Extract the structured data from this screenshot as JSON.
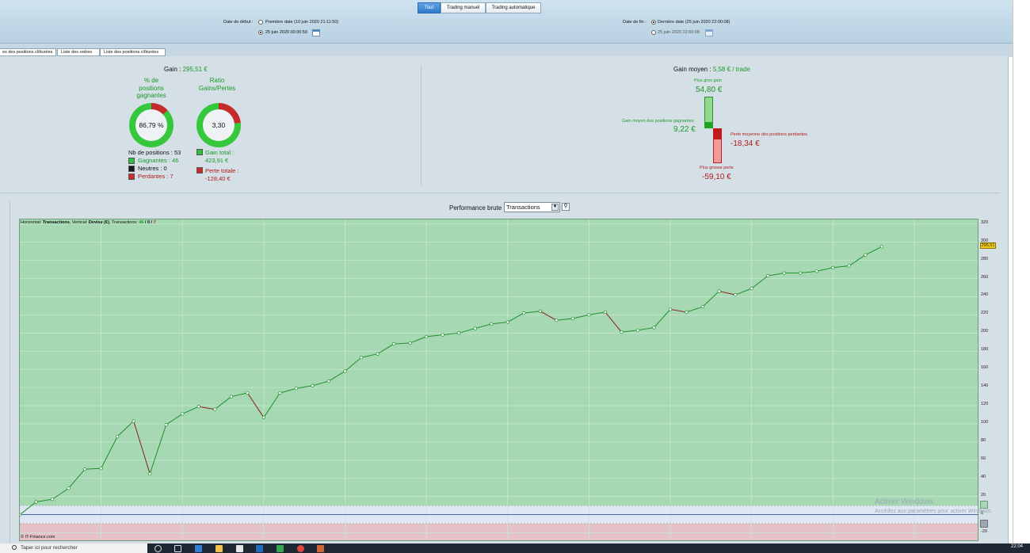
{
  "header": {
    "modes": [
      "Tout",
      "Trading manuel",
      "Trading automatique"
    ],
    "active_mode": "Tout",
    "start_label": "Date de début :",
    "start_opt1": "Première date (10 juin 2020 21:11:50)",
    "start_opt2": "25 juin 2020 00:00:50",
    "end_label": "Date de fin :",
    "end_opt1": "Dernière date (25 juin 2020 22:00:08)",
    "end_opt2": "25 juin 2020 22:00:08"
  },
  "tabs": [
    "es des positions clôturées",
    "Liste des ordres",
    "Liste des positions clôturées"
  ],
  "summary": {
    "gain_label": "Gain : ",
    "gain_value": "295,51 €",
    "pct_title_1": "% de",
    "pct_title_2": "positions",
    "pct_title_3": "gagnantes",
    "pct_value": "86,79 %",
    "pct_fraction": 0.8679,
    "ratio_title_1": "Ratio",
    "ratio_title_2": "Gains/Pertes",
    "ratio_value": "3,30",
    "ratio_fraction": 0.768,
    "nb_positions": "Nb de positions : 53",
    "gagnantes": "Gagnantes : 46",
    "neutres": "Neutres : 0",
    "perdantes": "Perdantes : 7",
    "gain_total_label": "Gain total :",
    "gain_total_value": "423,91 €",
    "perte_totale_label": "Perte totale :",
    "perte_totale_value": "-128,40 €"
  },
  "average": {
    "label": "Gain moyen : ",
    "value": "5,58 € / trade",
    "plus_gros_gain_label": "Plus gros gain",
    "plus_gros_gain_value": "54,80 €",
    "gain_moyen_label": "Gain moyen des positions gagnantes",
    "gain_moyen_value": "9,22 €",
    "perte_moyenne_label": "Perte moyenne des positions perdantes",
    "perte_moyenne_value": "-18,34 €",
    "plus_grosse_perte_label": "Plus grosse perte",
    "plus_grosse_perte_value": "-59,10 €"
  },
  "performance": {
    "title": "Performance brute",
    "select_value": "Transactions",
    "info_prefix": "Horizontal: ",
    "info_h": "Transactions",
    "info_mid": ", Vertical: ",
    "info_v": "Devise (€)",
    "info_tx": ", Transactions: ",
    "info_win": "46",
    "info_sep1": " / ",
    "info_neu": "0",
    "info_sep2": " / ",
    "info_lose": "7",
    "copyright": "© IT-Finance.com",
    "current_value_badge": "295,51"
  },
  "chart_data": {
    "type": "line",
    "title": "Performance brute",
    "xlabel": "Transactions",
    "ylabel": "Devise (€)",
    "ylim": [
      -30,
      325
    ],
    "yticks": [
      320,
      300,
      280,
      260,
      240,
      220,
      200,
      180,
      160,
      140,
      120,
      100,
      80,
      60,
      40,
      20,
      0,
      -20
    ],
    "x": [
      0,
      1,
      2,
      3,
      4,
      5,
      6,
      7,
      8,
      9,
      10,
      11,
      12,
      13,
      14,
      15,
      16,
      17,
      18,
      19,
      20,
      21,
      22,
      23,
      24,
      25,
      26,
      27,
      28,
      29,
      30,
      31,
      32,
      33,
      34,
      35,
      36,
      37,
      38,
      39,
      40,
      41,
      42,
      43,
      44,
      45,
      46,
      47,
      48,
      49,
      50,
      51,
      52,
      53
    ],
    "values": [
      0,
      14,
      17,
      29,
      50,
      51,
      86,
      103,
      45,
      99,
      111,
      119,
      116,
      130,
      134,
      107,
      134,
      139,
      142,
      147,
      158,
      173,
      177,
      188,
      189,
      196,
      198,
      200,
      205,
      210,
      212,
      222,
      224,
      214,
      216,
      220,
      223,
      201,
      203,
      206,
      226,
      223,
      229,
      246,
      242,
      249,
      263,
      266,
      266,
      268,
      272,
      274,
      286,
      295
    ],
    "colors": {
      "up": "#1e8f2a",
      "down": "#8b1a1a",
      "zero_line": "#2e4fb0"
    }
  },
  "watermark": {
    "line1": "Activer Windows",
    "line2": "Accédez aux paramètres pour activer Windows."
  },
  "taskbar": {
    "search_placeholder": "Taper ici pour rechercher",
    "clock": "22:04"
  }
}
